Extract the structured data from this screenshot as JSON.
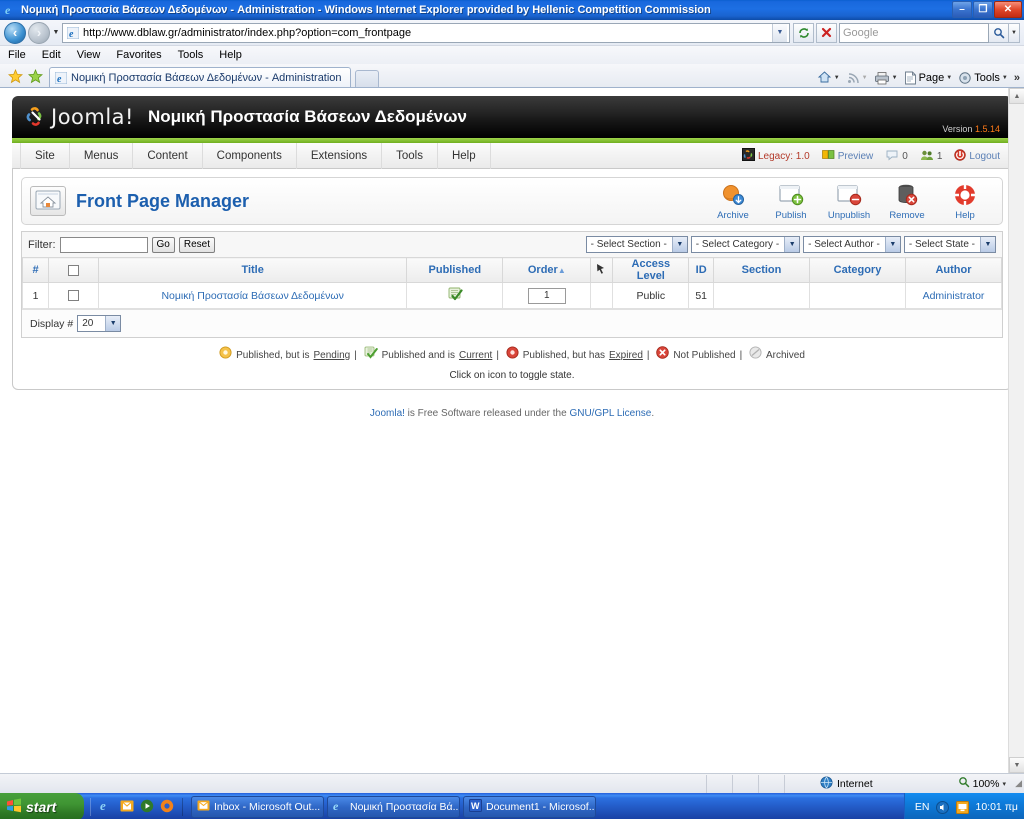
{
  "window": {
    "title": "Νομική Προστασία Βάσεων Δεδομένων - Administration - Windows Internet Explorer provided by Hellenic Competition Commission",
    "minimize_label": "–",
    "maximize_label": "❐",
    "close_label": "✕"
  },
  "browser": {
    "url": "http://www.dblaw.gr/administrator/index.php?option=com_frontpage",
    "search_placeholder": "Google",
    "refresh_label": "↻",
    "stop_label": "✕",
    "search_go_label": "🔍",
    "menu": [
      "File",
      "Edit",
      "View",
      "Favorites",
      "Tools",
      "Help"
    ],
    "tab_label": "Νομική Προστασία Βάσεων Δεδομένων - Administration",
    "toolbar_right": [
      {
        "label": "",
        "icon": "home-icon"
      },
      {
        "label": "",
        "icon": "feed-icon"
      },
      {
        "label": "",
        "icon": "print-icon"
      },
      {
        "label": "Page",
        "icon": "page-icon"
      },
      {
        "label": "Tools",
        "icon": "tools-icon"
      }
    ],
    "overflow_label": "»"
  },
  "joomla": {
    "brand": "Joomla!",
    "site_name": "Νομική Προστασία Βάσεων Δεδομένων",
    "version_label": "Version",
    "version_number": "1.5.14",
    "nav": [
      "Site",
      "Menus",
      "Content",
      "Components",
      "Extensions",
      "Tools",
      "Help"
    ],
    "status_bar": {
      "legacy_label": "Legacy: 1.0",
      "preview_label": "Preview",
      "messages_count": "0",
      "users_count": "1",
      "logout_label": "Logout"
    },
    "page_title": "Front Page Manager",
    "toolbar": [
      {
        "label": "Archive",
        "icon": "archive-icon"
      },
      {
        "label": "Publish",
        "icon": "publish-icon"
      },
      {
        "label": "Unpublish",
        "icon": "unpublish-icon"
      },
      {
        "label": "Remove",
        "icon": "trash-icon"
      },
      {
        "label": "Help",
        "icon": "lifering-icon"
      }
    ],
    "filter": {
      "label": "Filter:",
      "value": "",
      "go_label": "Go",
      "reset_label": "Reset",
      "selects": [
        "- Select Section -",
        "- Select Category -",
        "- Select Author -",
        "- Select State -"
      ]
    },
    "table": {
      "headers": [
        "#",
        "",
        "Title",
        "Published",
        "Order",
        "",
        "Access Level",
        "ID",
        "Section",
        "Category",
        "Author"
      ],
      "rows": [
        {
          "num": "1",
          "title": "Νομική Προστασία Βάσεων Δεδομένων",
          "published": "current",
          "order": "1",
          "access": "Public",
          "id": "51",
          "section": "",
          "category": "",
          "author": "Administrator"
        }
      ]
    },
    "display": {
      "label": "Display #",
      "value": "20"
    },
    "legend": [
      {
        "text_before": "Published, but is ",
        "link": "Pending",
        "text_after": "",
        "color": "#f0ad4e",
        "icon": "pending-icon"
      },
      {
        "text_before": "Published and is ",
        "link": "Current",
        "text_after": "",
        "color": "#5cb85c",
        "icon": "current-icon"
      },
      {
        "text_before": "Published, but has ",
        "link": "Expired",
        "text_after": "",
        "color": "#d9534f",
        "icon": "expired-icon"
      },
      {
        "text_before": "Not Published",
        "link": "",
        "text_after": "",
        "color": "#d9534f",
        "icon": "not-published-icon"
      },
      {
        "text_before": "Archived",
        "link": "",
        "text_after": "",
        "color": "#bbbbbb",
        "icon": "archived-icon"
      }
    ],
    "hint": "Click on icon to toggle state.",
    "footer": {
      "brand": "Joomla!",
      "text_mid": " is Free Software released under the ",
      "license": "GNU/GPL License",
      "text_end": "."
    }
  },
  "statusbar": {
    "zone": "Internet",
    "zoom": "100%",
    "zoom_caret": "▾"
  },
  "taskbar": {
    "start_label": "start",
    "tasks": [
      {
        "label": "Inbox - Microsoft Out...",
        "icon": "outlook-icon"
      },
      {
        "label": "Νομική Προστασία Βά...",
        "icon": "ie-icon"
      },
      {
        "label": "Document1 - Microsof...",
        "icon": "word-icon"
      }
    ],
    "tray": {
      "language": "EN",
      "clock": "10:01 πμ"
    }
  },
  "colors": {
    "accent_blue": "#2d6cb5",
    "joomla_green": "#8cc63f",
    "orange": "#ff7a18",
    "titlebar_blue": "#1868dd"
  }
}
